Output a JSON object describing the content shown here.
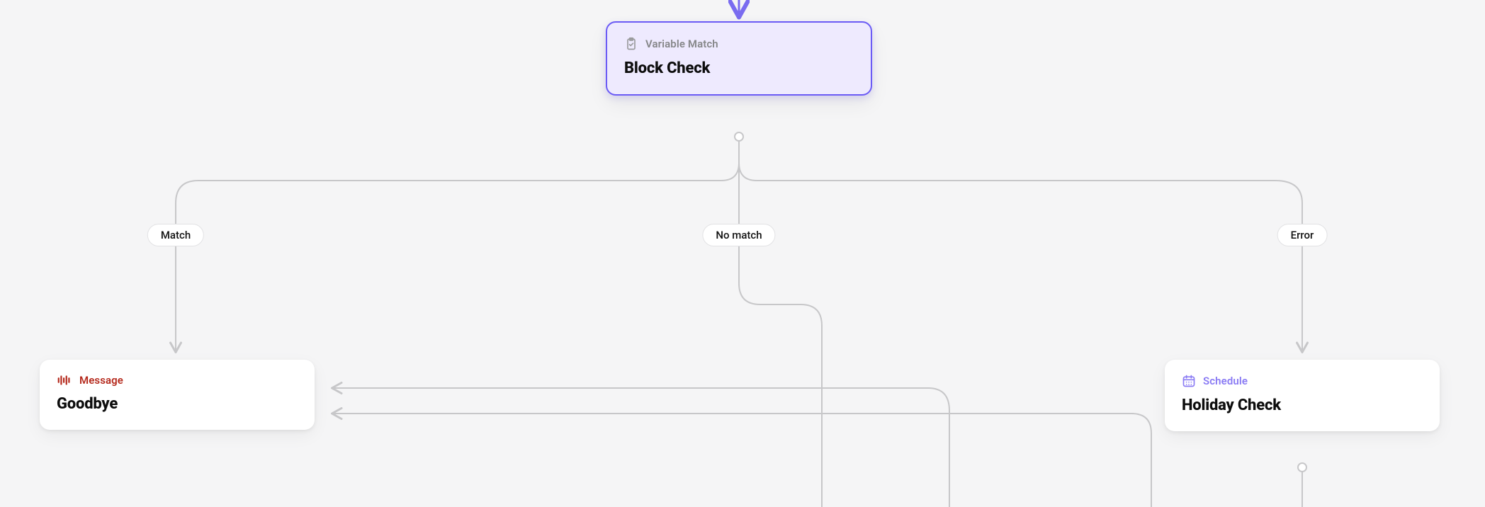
{
  "colors": {
    "canvas_bg": "#f5f5f6",
    "edge": "#c7c7c9",
    "accent": "#6b5bf5",
    "accent_bg": "#eeeafe",
    "red": "#b52a1d",
    "purple": "#8a7bf4",
    "gray": "#868789"
  },
  "nodes": {
    "block_check": {
      "type_label": "Variable Match",
      "title": "Block Check",
      "icon": "clipboard-check-icon",
      "selected": true
    },
    "goodbye": {
      "type_label": "Message",
      "title": "Goodbye",
      "icon": "audio-wave-icon",
      "selected": false
    },
    "holiday_check": {
      "type_label": "Schedule",
      "title": "Holiday Check",
      "icon": "calendar-icon",
      "selected": false
    }
  },
  "branches": {
    "match": "Match",
    "no_match": "No match",
    "error": "Error"
  }
}
